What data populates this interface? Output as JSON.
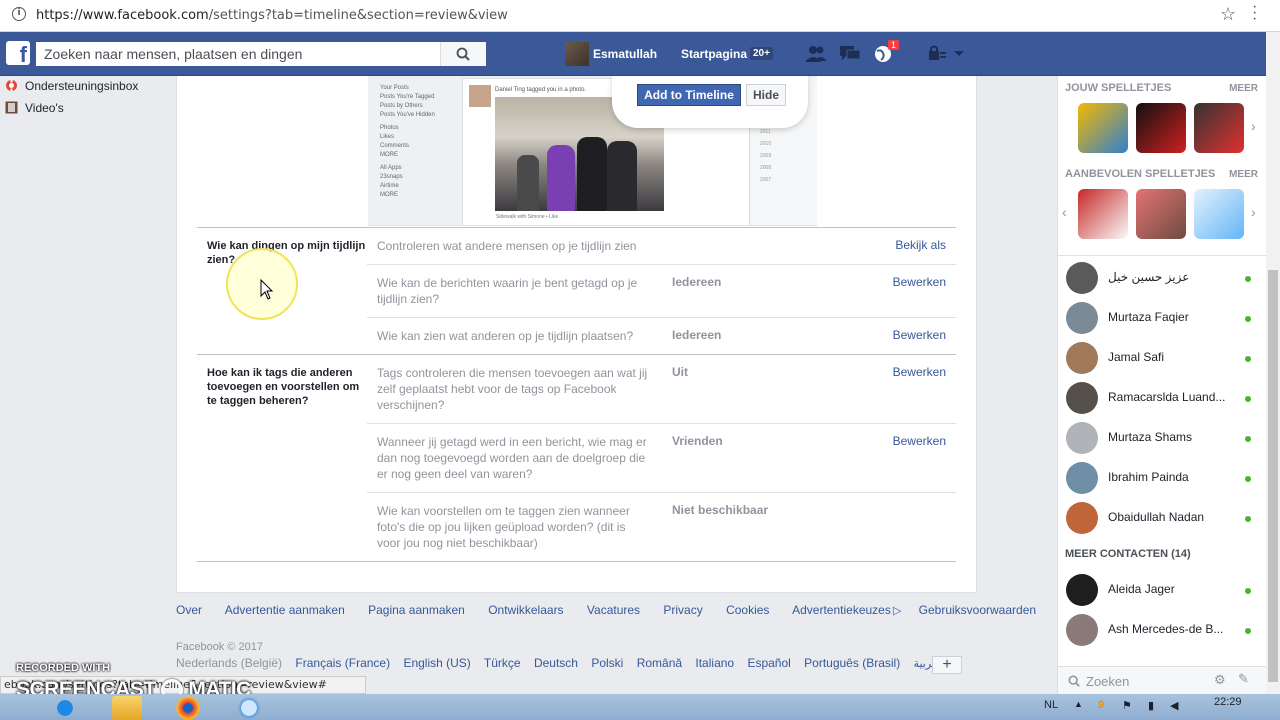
{
  "browser": {
    "url_host": "https://www.facebook.com",
    "url_path": "/settings?tab=timeline&section=review&view"
  },
  "topbar": {
    "search_placeholder": "Zoeken naar mensen, plaatsen en dingen",
    "user_name": "Esmatullah",
    "home_label": "Startpagina",
    "home_badge": "20+",
    "notif_count": "1"
  },
  "leftnav": {
    "items": [
      {
        "label": "Ondersteuningsinbox",
        "icon": "lifebuoy-icon"
      },
      {
        "label": "Video's",
        "icon": "film-icon"
      }
    ]
  },
  "preview": {
    "nav_items": [
      "Your Posts",
      "Posts You're Tagged",
      "Posts by Others",
      "Posts You've Hidden",
      "Photos",
      "Likes",
      "Comments",
      "MORE",
      "All Apps",
      "23snaps",
      "Airtime",
      "MORE"
    ],
    "tag_line": "Daniel Ting tagged you in a photo.",
    "caption": "Sidewalk with Simone • Like",
    "years": [
      "2011",
      "2010",
      "2009",
      "2008",
      "2007"
    ],
    "add_button": "Add to Timeline",
    "hide_button": "Hide"
  },
  "settings": {
    "sections": [
      {
        "title": "Wie kan dingen op mijn tijdlijn zien?",
        "rows": [
          {
            "question": "Controleren wat andere mensen op je tijdlijn zien",
            "value": "",
            "action": "Bekijk als"
          },
          {
            "question": "Wie kan de berichten waarin je bent getagd op je tijdlijn zien?",
            "value": "Iedereen",
            "action": "Bewerken"
          },
          {
            "question": "Wie kan zien wat anderen op je tijdlijn plaatsen?",
            "value": "Iedereen",
            "action": "Bewerken"
          }
        ]
      },
      {
        "title": "Hoe kan ik tags die anderen toevoegen en voorstellen om te taggen beheren?",
        "rows": [
          {
            "question": "Tags controleren die mensen toevoegen aan wat jij zelf geplaatst hebt voor de tags op Facebook verschijnen?",
            "value": "Uit",
            "action": "Bewerken"
          },
          {
            "question": "Wanneer jij getagd werd in een bericht, wie mag er dan nog toegevoegd worden aan de doelgroep die er nog geen deel van waren?",
            "value": "Vrienden",
            "action": "Bewerken"
          },
          {
            "question": "Wie kan voorstellen om te taggen zien wanneer foto's die op jou lijken geüpload worden? (dit is voor jou nog niet beschikbaar)",
            "value": "Niet beschikbaar",
            "action": ""
          }
        ]
      }
    ]
  },
  "footer": {
    "links": [
      "Over",
      "Advertentie aanmaken",
      "Pagina aanmaken",
      "Ontwikkelaars",
      "Vacatures",
      "Privacy",
      "Cookies",
      "Advertentiekeuzes",
      "Gebruiksvoorwaarden"
    ],
    "copyright": "Facebook © 2017",
    "languages": [
      "Nederlands (België)",
      "Français (France)",
      "English (US)",
      "Türkçe",
      "Deutsch",
      "Polski",
      "Română",
      "Italiano",
      "Español",
      "Português (Brasil)",
      "العربية"
    ],
    "add_language": "+"
  },
  "sidebar": {
    "games_header": "JOUW SPELLETJES",
    "more_label": "MEER",
    "recommended_header": "AANBEVOLEN SPELLETJES",
    "contacts": [
      {
        "name": "عزیز حسین خیل"
      },
      {
        "name": "Murtaza Faqier"
      },
      {
        "name": "Jamal Safi"
      },
      {
        "name": "Ramacarslda Luand..."
      },
      {
        "name": "Murtaza Shams"
      },
      {
        "name": "Ibrahim Painda"
      },
      {
        "name": "Obaidullah Nadan"
      }
    ],
    "more_contacts_header": "MEER CONTACTEN (14)",
    "more_contacts": [
      {
        "name": "Aleida Jager"
      },
      {
        "name": "Ash Mercedes-de B..."
      }
    ],
    "chat_search_placeholder": "Zoeken"
  },
  "status_url": "ebook.com/settings?tab=timeline&section=review&view#",
  "watermark": {
    "line1": "RECORDED WITH",
    "line2": "SCREENCAST",
    "line3": "MATIC"
  },
  "taskbar": {
    "lang": "NL",
    "time": "22:29"
  }
}
